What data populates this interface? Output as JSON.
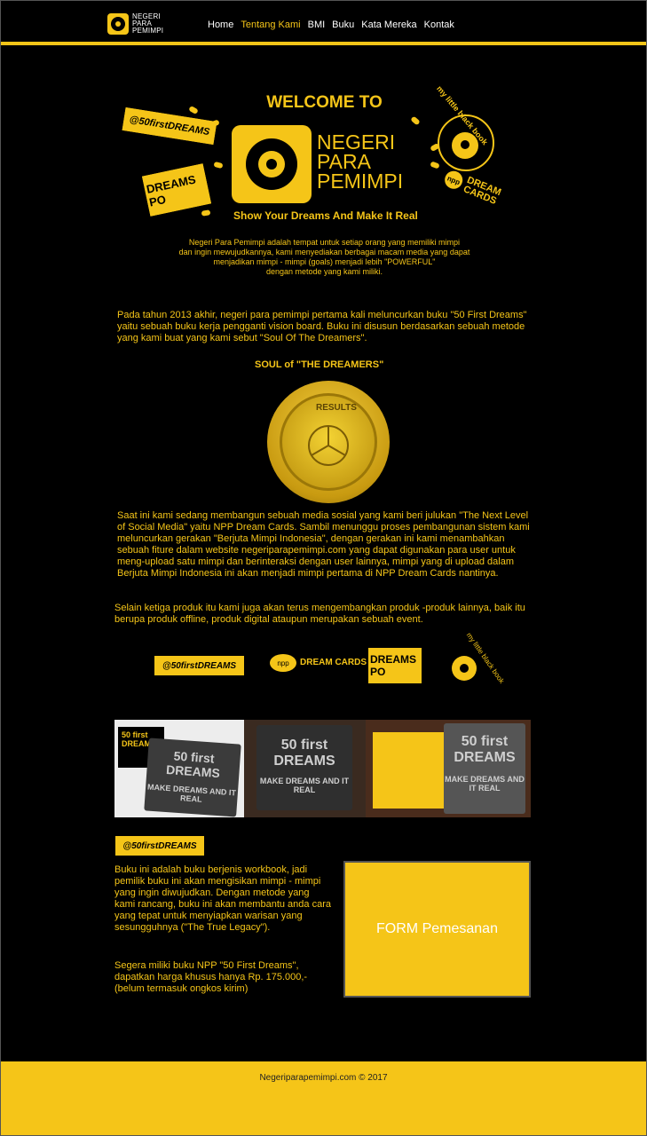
{
  "header": {
    "brand": [
      "NEGERI",
      "PARA",
      "PEMIMPI"
    ],
    "nav": [
      "Home",
      "Tentang Kami",
      "BMI",
      "Buku",
      "Kata Mereka",
      "Kontak"
    ],
    "active_nav": "Tentang Kami"
  },
  "hero": {
    "welcome": "WELCOME TO",
    "title_lines": [
      "NEGERI",
      "PARA",
      "PEMIMPI"
    ],
    "tagline": "Show Your Dreams And Make It Real",
    "badge_50": "@50firstDREAMS",
    "badge_dpo": "DREAMS PO",
    "badge_black": "my little black book",
    "badge_npp_oval": "npp",
    "badge_npp_text": "DREAM CARDS"
  },
  "intro": {
    "line1": "Negeri Para Pemimpi adalah tempat untuk setiap orang yang memiliki mimpi",
    "line2": "dan ingin mewujudkannya, kami menyediakan berbagai macam media yang dapat",
    "line3": "menjadikan mimpi - mimpi (goals) menjadi lebih \"POWERFUL\"",
    "line4": "dengan metode yang kami miliki."
  },
  "para1": "Pada tahun 2013 akhir, negeri para pemimpi pertama kali meluncurkan buku \"50 First Dreams\" yaitu sebuah buku kerja pengganti vision board. Buku ini disusun berdasarkan sebuah metode yang kami buat yang kami sebut \"Soul Of The Dreamers\".",
  "soul": {
    "arc_text": "SOUL of \"THE DREAMERS\"",
    "medal_text": "RESULTS"
  },
  "para2": "Saat ini kami sedang membangun sebuah media sosial yang kami beri julukan \"The Next Level of Social Media\" yaitu NPP Dream Cards. Sambil menunggu proses pembangunan sistem kami meluncurkan gerakan \"Berjuta Mimpi Indonesia\", dengan gerakan ini kami menambahkan sebuah fiture dalam website negeriparapemimpi.com yang dapat digunakan para user untuk meng-upload satu mimpi dan berinteraksi dengan user lainnya, mimpi yang di upload dalam Berjuta Mimpi Indonesia ini akan menjadi mimpi pertama di NPP Dream Cards nantinya.",
  "para3": "Selain ketiga produk itu kami juga akan terus mengembangkan produk -produk lainnya, baik itu berupa produk offline, produk digital ataupun merupakan sebuah event.",
  "products": {
    "p1": "@50firstDREAMS",
    "p2_oval": "npp",
    "p2_text": "DREAM CARDS",
    "p3": "DREAMS PO",
    "p4": "my little black book"
  },
  "photos": {
    "book_title": "50 first DREAMS",
    "cover_sub": "MAKE DREAMS AND IT REAL"
  },
  "book": {
    "logo": "@50firstDREAMS",
    "desc": "Buku ini adalah buku berjenis workbook, jadi pemilik buku ini akan mengisikan mimpi - mimpi yang ingin diwujudkan. Dengan metode yang kami rancang, buku ini akan membantu anda cara yang tepat untuk menyiapkan warisan yang sesungguhnya (\"The True Legacy\").",
    "offer": "Segera miliki buku NPP \"50 First Dreams\", dapatkan harga khusus hanya Rp. 175.000,- (belum termasuk ongkos kirim)"
  },
  "form": {
    "label": "FORM Pemesanan"
  },
  "footer": {
    "text": "Negeriparapemimpi.com © 2017"
  },
  "colors": {
    "accent": "#f5c518",
    "background": "#000000"
  }
}
